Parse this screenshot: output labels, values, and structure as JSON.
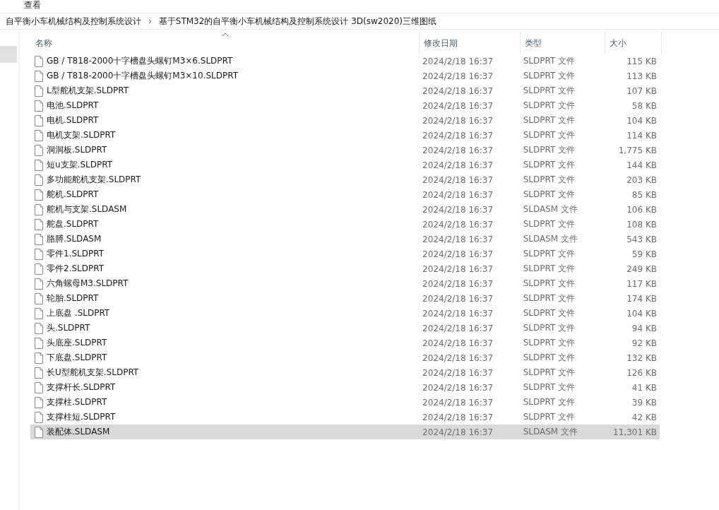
{
  "ribbon": {
    "tab": "查看"
  },
  "breadcrumb": [
    "自平衡小车机械结构及控制系统设计",
    "基于STM32的自平衡小车机械结构及控制系统设计 3D(sw2020)三维图纸"
  ],
  "breadcrumb_separator": "›",
  "table": {
    "columns": [
      {
        "label": "名称",
        "sorted": true
      },
      {
        "label": "修改日期",
        "sorted": false
      },
      {
        "label": "类型",
        "sorted": false
      },
      {
        "label": "大小",
        "sorted": false
      }
    ],
    "rows": [
      {
        "name": "GB / T818-2000十字槽盘头螺钉M3×6.SLDPRT",
        "date": "2024/2/18 16:37",
        "type": "SLDPRT 文件",
        "size": "115 KB",
        "selected": false
      },
      {
        "name": "GB / T818-2000十字槽盘头螺钉M3×10.SLDPRT",
        "date": "2024/2/18 16:37",
        "type": "SLDPRT 文件",
        "size": "113 KB",
        "selected": false
      },
      {
        "name": "L型舵机支架.SLDPRT",
        "date": "2024/2/18 16:37",
        "type": "SLDPRT 文件",
        "size": "107 KB",
        "selected": false
      },
      {
        "name": "电池.SLDPRT",
        "date": "2024/2/18 16:37",
        "type": "SLDPRT 文件",
        "size": "58 KB",
        "selected": false
      },
      {
        "name": "电机.SLDPRT",
        "date": "2024/2/18 16:37",
        "type": "SLDPRT 文件",
        "size": "104 KB",
        "selected": false
      },
      {
        "name": "电机支架.SLDPRT",
        "date": "2024/2/18 16:37",
        "type": "SLDPRT 文件",
        "size": "114 KB",
        "selected": false
      },
      {
        "name": "洞洞板.SLDPRT",
        "date": "2024/2/18 16:37",
        "type": "SLDPRT 文件",
        "size": "1,775 KB",
        "selected": false
      },
      {
        "name": "短u支架.SLDPRT",
        "date": "2024/2/18 16:37",
        "type": "SLDPRT 文件",
        "size": "144 KB",
        "selected": false
      },
      {
        "name": "多功能舵机支架.SLDPRT",
        "date": "2024/2/18 16:37",
        "type": "SLDPRT 文件",
        "size": "203 KB",
        "selected": false
      },
      {
        "name": "舵机.SLDPRT",
        "date": "2024/2/18 16:37",
        "type": "SLDPRT 文件",
        "size": "85 KB",
        "selected": false
      },
      {
        "name": "舵机与支架.SLDASM",
        "date": "2024/2/18 16:37",
        "type": "SLDASM 文件",
        "size": "106 KB",
        "selected": false
      },
      {
        "name": "舵盘.SLDPRT",
        "date": "2024/2/18 16:37",
        "type": "SLDPRT 文件",
        "size": "108 KB",
        "selected": false
      },
      {
        "name": "胳膊.SLDASM",
        "date": "2024/2/18 16:37",
        "type": "SLDASM 文件",
        "size": "543 KB",
        "selected": false
      },
      {
        "name": "零件1.SLDPRT",
        "date": "2024/2/18 16:37",
        "type": "SLDPRT 文件",
        "size": "59 KB",
        "selected": false
      },
      {
        "name": "零件2.SLDPRT",
        "date": "2024/2/18 16:37",
        "type": "SLDPRT 文件",
        "size": "249 KB",
        "selected": false
      },
      {
        "name": "六角螺母M3.SLDPRT",
        "date": "2024/2/18 16:37",
        "type": "SLDPRT 文件",
        "size": "117 KB",
        "selected": false
      },
      {
        "name": "轮胎.SLDPRT",
        "date": "2024/2/18 16:37",
        "type": "SLDPRT 文件",
        "size": "174 KB",
        "selected": false
      },
      {
        "name": "上底盘 .SLDPRT",
        "date": "2024/2/18 16:37",
        "type": "SLDPRT 文件",
        "size": "104 KB",
        "selected": false
      },
      {
        "name": "头.SLDPRT",
        "date": "2024/2/18 16:37",
        "type": "SLDPRT 文件",
        "size": "94 KB",
        "selected": false
      },
      {
        "name": "头底座.SLDPRT",
        "date": "2024/2/18 16:37",
        "type": "SLDPRT 文件",
        "size": "92 KB",
        "selected": false
      },
      {
        "name": "下底盘.SLDPRT",
        "date": "2024/2/18 16:37",
        "type": "SLDPRT 文件",
        "size": "132 KB",
        "selected": false
      },
      {
        "name": "长U型舵机支架.SLDPRT",
        "date": "2024/2/18 16:37",
        "type": "SLDPRT 文件",
        "size": "126 KB",
        "selected": false
      },
      {
        "name": "支撑杆长.SLDPRT",
        "date": "2024/2/18 16:37",
        "type": "SLDPRT 文件",
        "size": "41 KB",
        "selected": false
      },
      {
        "name": "支撑柱.SLDPRT",
        "date": "2024/2/18 16:37",
        "type": "SLDPRT 文件",
        "size": "39 KB",
        "selected": false
      },
      {
        "name": "支撑柱短.SLDPRT",
        "date": "2024/2/18 16:37",
        "type": "SLDPRT 文件",
        "size": "42 KB",
        "selected": false
      },
      {
        "name": "装配体.SLDASM",
        "date": "2024/2/18 16:37",
        "type": "SLDASM 文件",
        "size": "11,301 KB",
        "selected": true
      }
    ]
  }
}
